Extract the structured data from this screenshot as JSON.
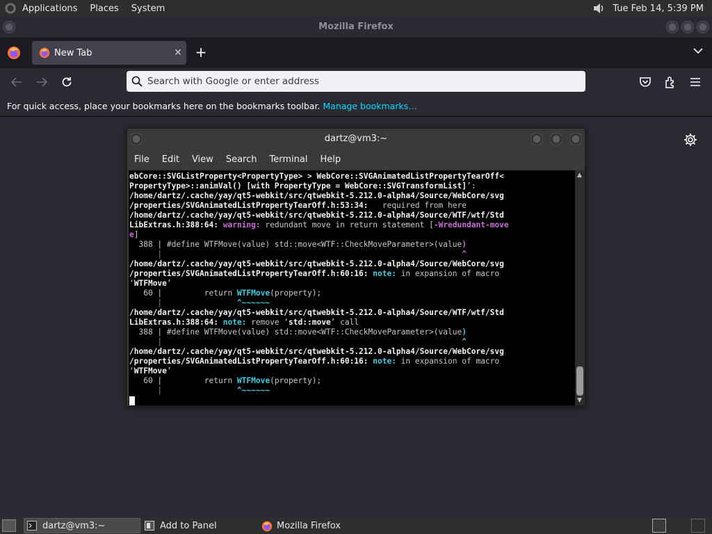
{
  "top_panel": {
    "menus": [
      "Applications",
      "Places",
      "System"
    ],
    "clock": "Tue Feb 14,  5:39 PM"
  },
  "firefox": {
    "window_title": "Mozilla Firefox",
    "tab": {
      "title": "New Tab",
      "close": "✕"
    },
    "new_tab": "+",
    "urlbar_placeholder": "Search with Google or enter address",
    "bookmarks_message": "For quick access, place your bookmarks here on the bookmarks toolbar. ",
    "manage_bookmarks": "Manage bookmarks…"
  },
  "terminal": {
    "title": "dartz@vm3:~",
    "menu": [
      "File",
      "Edit",
      "View",
      "Search",
      "Terminal",
      "Help"
    ],
    "lines": [
      [
        {
          "t": "ebCore::SVGListProperty<PropertyType> > WebCore::SVGAnimatedListPropertyTearOff<",
          "c": "b"
        }
      ],
      [
        {
          "t": "PropertyType>::animVal() [with PropertyType = WebCore::SVGTransformList]",
          "c": "b"
        },
        {
          "t": "’:",
          "c": ""
        }
      ],
      [
        {
          "t": "/home/dartz/.cache/yay/qt5-webkit/src/qtwebkit-5.212.0-alpha4/Source/WebCore/svg",
          "c": "b"
        }
      ],
      [
        {
          "t": "/properties/SVGAnimatedListPropertyTearOff.h:53:34:",
          "c": "b"
        },
        {
          "t": "   required from here",
          "c": ""
        }
      ],
      [
        {
          "t": "/home/dartz/.cache/yay/qt5-webkit/src/qtwebkit-5.212.0-alpha4/Source/WTF/wtf/Std",
          "c": "b"
        }
      ],
      [
        {
          "t": "LibExtras.h:388:64:",
          "c": "b"
        },
        {
          "t": " ",
          "c": ""
        },
        {
          "t": "warning:",
          "c": "warn"
        },
        {
          "t": " redundant move in return statement [",
          "c": ""
        },
        {
          "t": "-Wredundant-move",
          "c": "warn"
        }
      ],
      [
        {
          "t": "e",
          "c": "warn"
        },
        {
          "t": "]",
          "c": ""
        }
      ],
      [
        {
          "t": "  388 | #define WTFMove(value) std::move<WTF::CheckMoveParameter>(value",
          "c": ""
        },
        {
          "t": ")",
          "c": "warn"
        }
      ],
      [
        {
          "t": "      |                                                                ",
          "c": "grey"
        },
        {
          "t": "^",
          "c": "warn"
        }
      ],
      [
        {
          "t": "/home/dartz/.cache/yay/qt5-webkit/src/qtwebkit-5.212.0-alpha4/Source/WebCore/svg",
          "c": "b"
        }
      ],
      [
        {
          "t": "/properties/SVGAnimatedListPropertyTearOff.h:60:16:",
          "c": "b"
        },
        {
          "t": " ",
          "c": ""
        },
        {
          "t": "note:",
          "c": "note"
        },
        {
          "t": " in expansion of macro",
          "c": ""
        }
      ],
      [
        {
          "t": "‘",
          "c": ""
        },
        {
          "t": "WTFMove",
          "c": "b"
        },
        {
          "t": "’",
          "c": ""
        }
      ],
      [
        {
          "t": "   60 |         return ",
          "c": ""
        },
        {
          "t": "WTFMove",
          "c": "cy"
        },
        {
          "t": "(property);",
          "c": ""
        }
      ],
      [
        {
          "t": "      |                ",
          "c": "grey"
        },
        {
          "t": "^~~~~~~",
          "c": "cy"
        }
      ],
      [
        {
          "t": "/home/dartz/.cache/yay/qt5-webkit/src/qtwebkit-5.212.0-alpha4/Source/WTF/wtf/Std",
          "c": "b"
        }
      ],
      [
        {
          "t": "LibExtras.h:388:64:",
          "c": "b"
        },
        {
          "t": " ",
          "c": ""
        },
        {
          "t": "note:",
          "c": "note"
        },
        {
          "t": " remove ‘",
          "c": ""
        },
        {
          "t": "std::move",
          "c": "b"
        },
        {
          "t": "’ call",
          "c": ""
        }
      ],
      [
        {
          "t": "  388 | #define WTFMove(value) std::move<WTF::CheckMoveParameter>(value",
          "c": ""
        },
        {
          "t": ")",
          "c": "cy"
        }
      ],
      [
        {
          "t": "      |                                                                ",
          "c": "grey"
        },
        {
          "t": "^",
          "c": "cy"
        }
      ],
      [
        {
          "t": "/home/dartz/.cache/yay/qt5-webkit/src/qtwebkit-5.212.0-alpha4/Source/WebCore/svg",
          "c": "b"
        }
      ],
      [
        {
          "t": "/properties/SVGAnimatedListPropertyTearOff.h:60:16:",
          "c": "b"
        },
        {
          "t": " ",
          "c": ""
        },
        {
          "t": "note:",
          "c": "note"
        },
        {
          "t": " in expansion of macro",
          "c": ""
        }
      ],
      [
        {
          "t": "‘",
          "c": ""
        },
        {
          "t": "WTFMove",
          "c": "b"
        },
        {
          "t": "’",
          "c": ""
        }
      ],
      [
        {
          "t": "   60 |         return ",
          "c": ""
        },
        {
          "t": "WTFMove",
          "c": "cy"
        },
        {
          "t": "(property);",
          "c": ""
        }
      ],
      [
        {
          "t": "      |                ",
          "c": "grey"
        },
        {
          "t": "^~~~~~~",
          "c": "cy"
        }
      ]
    ]
  },
  "taskbar": {
    "items": [
      {
        "label": "dartz@vm3:~",
        "icon": "terminal-icon",
        "active": true
      },
      {
        "label": "Add to Panel",
        "icon": "panel-icon",
        "active": false
      },
      {
        "label": "Mozilla Firefox",
        "icon": "firefox-icon",
        "active": false
      }
    ]
  },
  "colors": {
    "firefox_bg": "#2b2a33",
    "terminal_bg": "#000000",
    "warning": "#c86bd6",
    "note": "#3ecbe0",
    "link": "#00ddff"
  }
}
